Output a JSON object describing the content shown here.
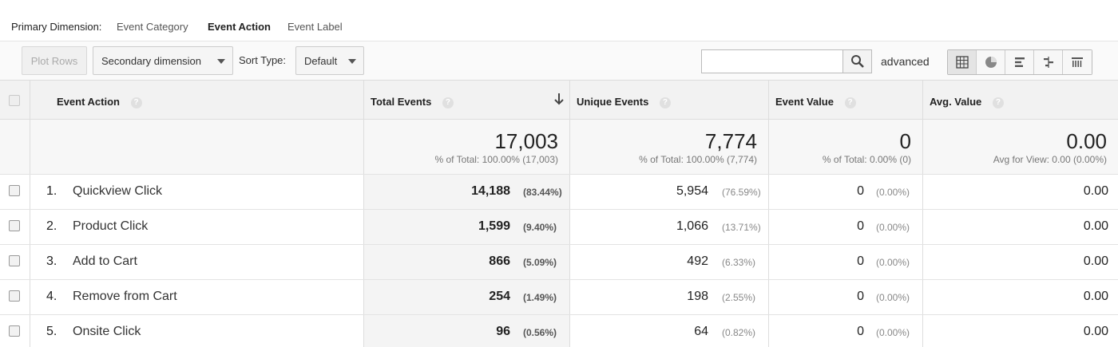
{
  "primary_dimension": {
    "label": "Primary Dimension:",
    "options": [
      "Event Category",
      "Event Action",
      "Event Label"
    ],
    "active": "Event Action"
  },
  "toolbar": {
    "plot_rows": "Plot Rows",
    "secondary_dimension": "Secondary dimension",
    "sort_type_label": "Sort Type:",
    "sort_type_value": "Default",
    "search_value": "",
    "advanced": "advanced",
    "view_icons": [
      "table-view-icon",
      "pie-view-icon",
      "performance-view-icon",
      "comparison-view-icon",
      "pivot-view-icon"
    ]
  },
  "columns": {
    "event_action": "Event Action",
    "total_events": "Total Events",
    "unique_events": "Unique Events",
    "event_value": "Event Value",
    "avg_value": "Avg. Value",
    "help_glyph": "?"
  },
  "totals": {
    "total_events": "17,003",
    "total_events_sub": "% of Total: 100.00% (17,003)",
    "unique_events": "7,774",
    "unique_events_sub": "% of Total: 100.00% (7,774)",
    "event_value": "0",
    "event_value_sub": "% of Total: 0.00% (0)",
    "avg_value": "0.00",
    "avg_value_sub": "Avg for View: 0.00 (0.00%)"
  },
  "rows": [
    {
      "index": "1.",
      "action": "Quickview Click",
      "total": "14,188",
      "total_pct": "(83.44%)",
      "unique": "5,954",
      "unique_pct": "(76.59%)",
      "value": "0",
      "value_pct": "(0.00%)",
      "avg": "0.00"
    },
    {
      "index": "2.",
      "action": "Product Click",
      "total": "1,599",
      "total_pct": "(9.40%)",
      "unique": "1,066",
      "unique_pct": "(13.71%)",
      "value": "0",
      "value_pct": "(0.00%)",
      "avg": "0.00"
    },
    {
      "index": "3.",
      "action": "Add to Cart",
      "total": "866",
      "total_pct": "(5.09%)",
      "unique": "492",
      "unique_pct": "(6.33%)",
      "value": "0",
      "value_pct": "(0.00%)",
      "avg": "0.00"
    },
    {
      "index": "4.",
      "action": "Remove from Cart",
      "total": "254",
      "total_pct": "(1.49%)",
      "unique": "198",
      "unique_pct": "(2.55%)",
      "value": "0",
      "value_pct": "(0.00%)",
      "avg": "0.00"
    },
    {
      "index": "5.",
      "action": "Onsite Click",
      "total": "96",
      "total_pct": "(0.56%)",
      "unique": "64",
      "unique_pct": "(0.82%)",
      "value": "0",
      "value_pct": "(0.00%)",
      "avg": "0.00"
    }
  ]
}
